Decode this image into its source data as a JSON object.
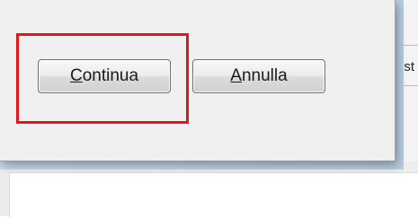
{
  "dialog": {
    "continue_button": {
      "mnemonic": "C",
      "rest": "ontinua"
    },
    "cancel_button": {
      "mnemonic": "A",
      "rest": "nnulla"
    }
  },
  "background_window": {
    "cell_text": "est"
  },
  "colors": {
    "highlight": "#e0161c",
    "dialog_background": "#f0f0f0"
  }
}
